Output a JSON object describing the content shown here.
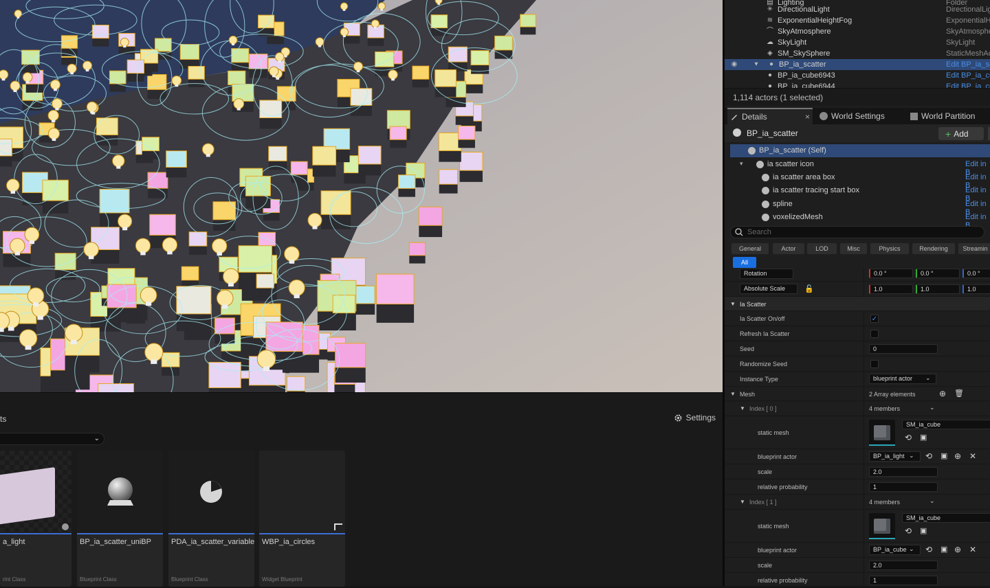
{
  "outliner": {
    "rows": [
      {
        "label": "Lighting",
        "type": "Folder",
        "icon": "folder-icon"
      },
      {
        "label": "DirectionalLight",
        "type": "DirectionalLig",
        "icon": "sun-icon"
      },
      {
        "label": "ExponentialHeightFog",
        "type": "ExponentialHe",
        "icon": "fog-icon"
      },
      {
        "label": "SkyAtmosphere",
        "type": "SkyAtmosphe",
        "icon": "sky-atmosphere-icon"
      },
      {
        "label": "SkyLight",
        "type": "SkyLight",
        "icon": "skylight-icon"
      },
      {
        "label": "SM_SkySphere",
        "type": "StaticMeshAc",
        "icon": "static-mesh-icon"
      },
      {
        "label": "BP_ia_scatter",
        "type": "Edit BP_ia_sc",
        "icon": "blueprint-icon"
      },
      {
        "label": "BP_ia_cube6943",
        "type": "Edit BP_ia_cu",
        "icon": "blueprint-icon"
      },
      {
        "label": "BP_ia_cube6944",
        "type": "Edit BP_ia_cu",
        "icon": "blueprint-icon"
      }
    ],
    "actor_count": "1,114 actors (1 selected)"
  },
  "tabs": {
    "details": "Details",
    "world_settings": "World Settings",
    "world_partition": "World Partition"
  },
  "details": {
    "actor_name": "BP_ia_scatter",
    "add_label": "Add",
    "components": [
      {
        "label": "BP_ia_scatter (Self)",
        "edit": ""
      },
      {
        "label": "ia scatter icon",
        "edit": "Edit in B"
      },
      {
        "label": "ia scatter area box",
        "edit": "Edit in B"
      },
      {
        "label": "ia scatter tracing start box",
        "edit": "Edit in B"
      },
      {
        "label": "spline",
        "edit": "Edit in B"
      },
      {
        "label": "voxelizedMesh",
        "edit": "Edit in B"
      }
    ],
    "search_placeholder": "Search",
    "filters": [
      "General",
      "Actor",
      "LOD",
      "Misc",
      "Physics",
      "Rendering",
      "Streamin",
      "All"
    ],
    "rotation_label": "Rotation",
    "rotation_values": [
      "0.0 °",
      "0.0 °",
      "0.0 °"
    ],
    "scale_label": "Absolute Scale",
    "scale_values": [
      "1.0",
      "1.0",
      "1.0"
    ],
    "category": "Ia Scatter",
    "props": {
      "on_off": "Ia Scatter On/off",
      "refresh": "Refresh Ia Scatter",
      "seed": "Seed",
      "seed_value": "0",
      "randomize": "Randomize Seed",
      "instance_type": "Instance Type",
      "instance_type_value": "blueprint actor",
      "mesh": "Mesh",
      "mesh_count": "2 Array elements"
    },
    "indices": [
      {
        "label": "Index [ 0 ]",
        "members": "4 members",
        "static_mesh_label": "static mesh",
        "static_mesh": "SM_ia_cube",
        "blueprint_label": "blueprint actor",
        "blueprint": "BP_ia_light",
        "scale_label": "scale",
        "scale": "2.0",
        "prob_label": "relative probability",
        "prob": "1"
      },
      {
        "label": "Index [ 1 ]",
        "members": "4 members",
        "static_mesh_label": "static mesh",
        "static_mesh": "SM_ia_cube",
        "blueprint_label": "blueprint actor",
        "blueprint": "BP_ia_cube",
        "scale_label": "scale",
        "scale": "2.0",
        "prob_label": "relative probability",
        "prob": "1"
      }
    ]
  },
  "content_browser": {
    "tab_label": "ts",
    "settings_label": "Settings",
    "assets": [
      {
        "name": "a_light",
        "class": "rint Class"
      },
      {
        "name": "BP_ia_scatter_uniBP",
        "class": "Blueprint Class"
      },
      {
        "name": "PDA_ia_scatter_variables",
        "class": "Blueprint Class"
      },
      {
        "name": "WBP_ia_circles",
        "class": "Widget Blueprint"
      }
    ]
  },
  "colors": {
    "selection": "#2f4a78",
    "link": "#4a8fe8",
    "accent": "#1a6fe0"
  }
}
